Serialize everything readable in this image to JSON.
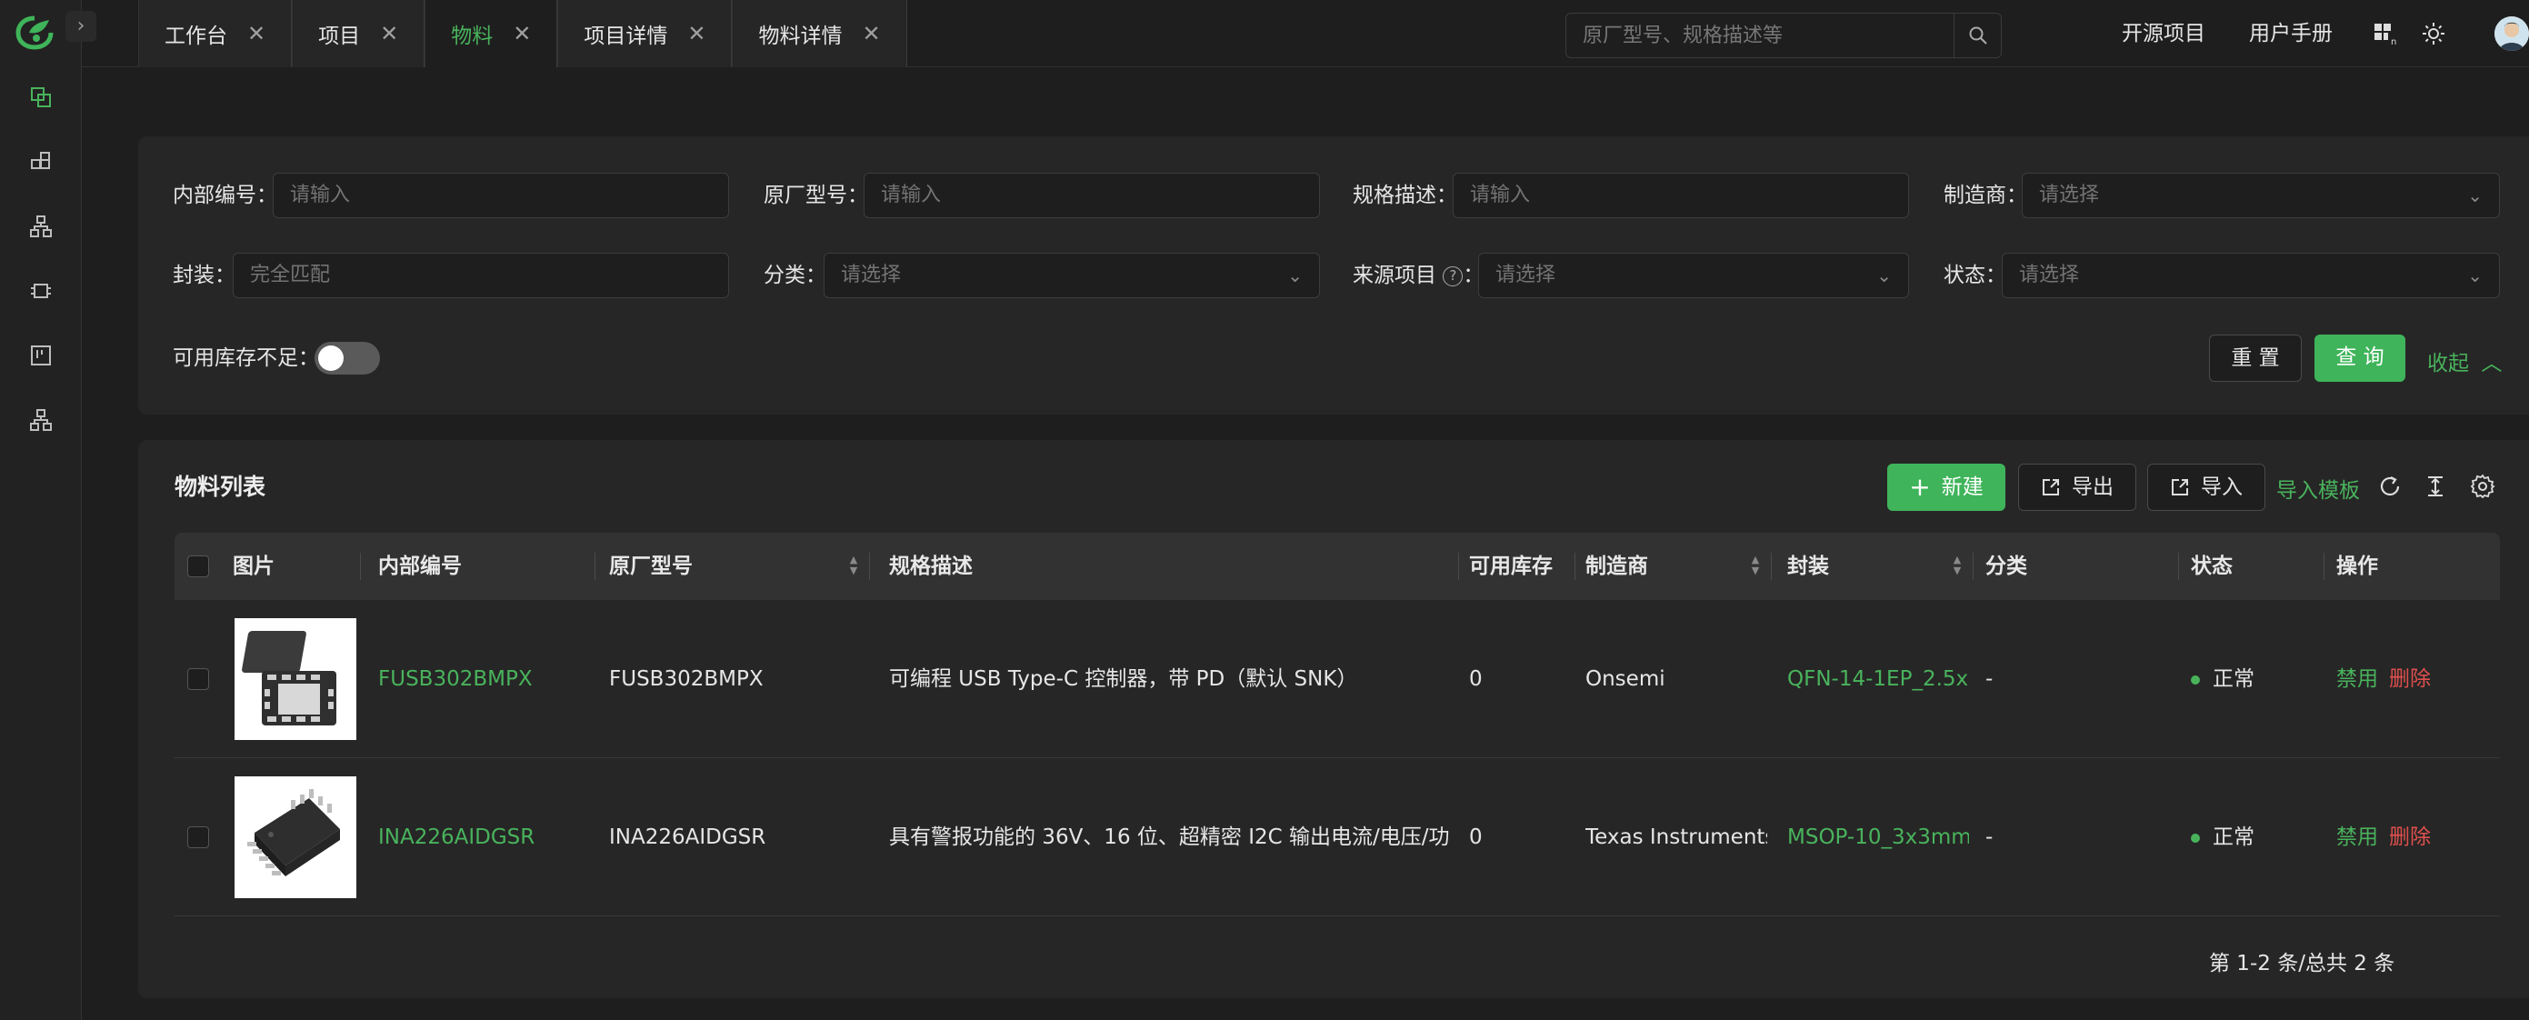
{
  "tabs": [
    {
      "label": "工作台",
      "active": false
    },
    {
      "label": "项目",
      "active": false
    },
    {
      "label": "物料",
      "active": true
    },
    {
      "label": "项目详情",
      "active": false
    },
    {
      "label": "物料详情",
      "active": false
    }
  ],
  "search": {
    "placeholder": "原厂型号、规格描述等"
  },
  "header_links": {
    "open_source": "开源项目",
    "manual": "用户手册"
  },
  "filters": {
    "internal_code": {
      "label": "内部编号",
      "placeholder": "请输入"
    },
    "mfr_part": {
      "label": "原厂型号",
      "placeholder": "请输入"
    },
    "spec": {
      "label": "规格描述",
      "placeholder": "请输入"
    },
    "manufacturer": {
      "label": "制造商",
      "placeholder": "请选择"
    },
    "package": {
      "label": "封装",
      "placeholder": "完全匹配"
    },
    "category": {
      "label": "分类",
      "placeholder": "请选择"
    },
    "source_project": {
      "label": "来源项目",
      "placeholder": "请选择"
    },
    "status": {
      "label": "状态",
      "placeholder": "请选择"
    },
    "low_stock": {
      "label": "可用库存不足",
      "value": false
    },
    "reset_label": "重 置",
    "query_label": "查 询",
    "collapse_label": "收起"
  },
  "list": {
    "title": "物料列表",
    "new_label": "新建",
    "export_label": "导出",
    "import_label": "导入",
    "template_label": "导入模板",
    "columns": {
      "image": "图片",
      "internal_code": "内部编号",
      "mfr_part": "原厂型号",
      "spec": "规格描述",
      "stock": "可用库存",
      "manufacturer": "制造商",
      "package": "封装",
      "category": "分类",
      "status": "状态",
      "actions": "操作"
    },
    "rows": [
      {
        "internal_code": "FUSB302BMPX",
        "mfr_part": "FUSB302BMPX",
        "spec": "可编程 USB Type-C 控制器，带 PD（默认 SNK）",
        "stock": "0",
        "manufacturer": "Onsemi",
        "package": "QFN-14-1EP_2.5x...",
        "category": "-",
        "status": "正常",
        "disable_label": "禁用",
        "delete_label": "删除"
      },
      {
        "internal_code": "INA226AIDGSR",
        "mfr_part": "INA226AIDGSR",
        "spec": "具有警报功能的 36V、16 位、超精密 I2C 输出电流/电压/功...",
        "stock": "0",
        "manufacturer": "Texas Instruments...",
        "package": "MSOP-10_3x3mm...",
        "category": "-",
        "status": "正常",
        "disable_label": "禁用",
        "delete_label": "删除"
      }
    ]
  },
  "pagination": {
    "summary": "第 1-2 条/总共 2 条",
    "current_page": "1"
  },
  "colors": {
    "accent": "#49b35c",
    "danger": "#e0504d",
    "background": "#1e1e1e",
    "panel": "#262626"
  }
}
